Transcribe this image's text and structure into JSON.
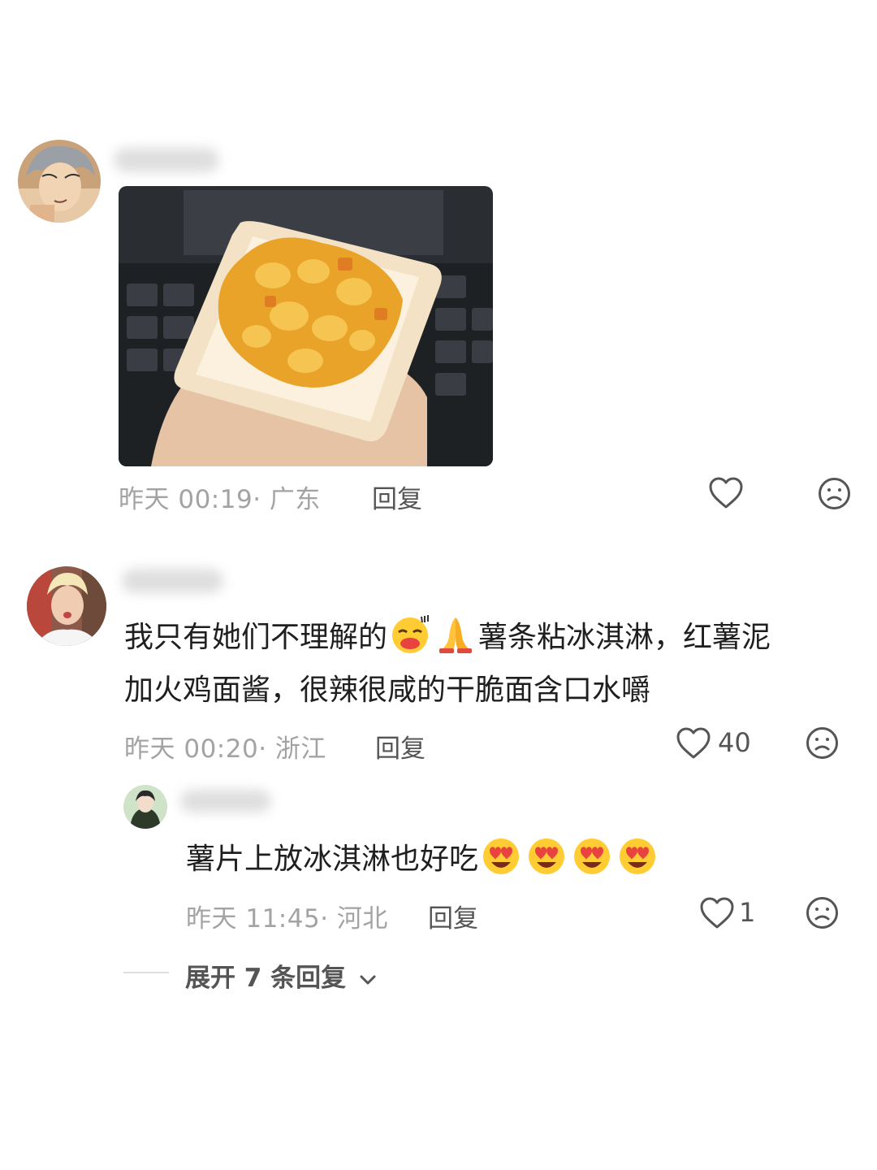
{
  "comments": [
    {
      "meta": "昨天 00:19· 广东",
      "reply_label": "回复",
      "has_image": true
    },
    {
      "text_line1": "我只有她们不理解的",
      "text_line1_after": "薯条粘冰淇淋，红薯泥",
      "text_line2": "加火鸡面酱，很辣很咸的干脆面含口水嚼",
      "meta": "昨天 00:20· 浙江",
      "reply_label": "回复",
      "likes": "40",
      "sub_reply": {
        "text": "薯片上放冰淇淋也好吃",
        "meta": "昨天 11:45· 河北",
        "reply_label": "回复",
        "likes": "1"
      },
      "expand_label": "展开 7 条回复"
    }
  ],
  "icons": {
    "like": "heart-outline-icon",
    "dislike": "sad-face-icon",
    "expand": "chevron-down-icon"
  },
  "colors": {
    "meta": "#a3a3a3",
    "text": "#1f1f1f",
    "icon": "#555555"
  }
}
